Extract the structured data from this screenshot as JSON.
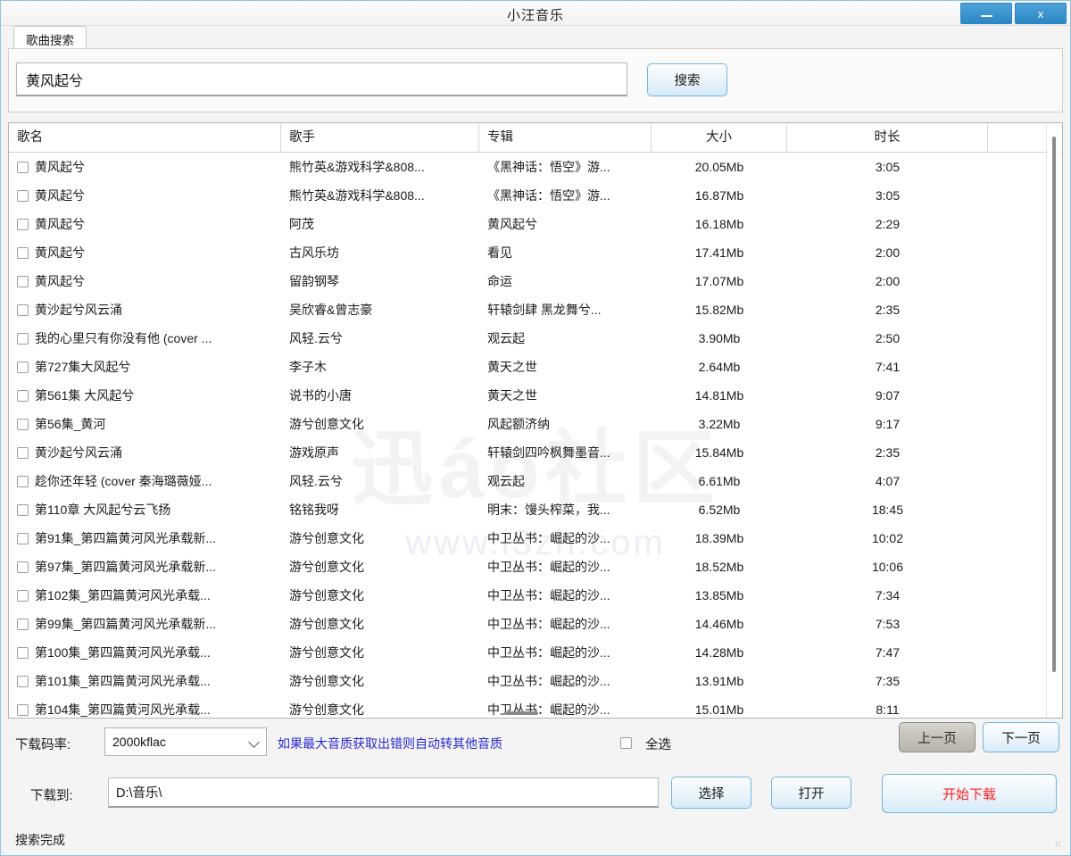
{
  "window": {
    "title": "小汪音乐",
    "minimize_icon": "minimize-icon",
    "close_label": "x"
  },
  "tabs": [
    {
      "label": "歌曲搜索"
    }
  ],
  "search": {
    "query": "黄风起兮",
    "placeholder": "",
    "button_label": "搜索"
  },
  "table": {
    "columns": [
      {
        "key": "name",
        "label": "歌名"
      },
      {
        "key": "artist",
        "label": "歌手"
      },
      {
        "key": "album",
        "label": "专辑"
      },
      {
        "key": "size",
        "label": "大小"
      },
      {
        "key": "duration",
        "label": "时长"
      }
    ],
    "rows": [
      {
        "name": "黄风起兮",
        "artist": "熊竹英&游戏科学&808...",
        "album": "《黑神话：悟空》游...",
        "size": "20.05Mb",
        "duration": "3:05"
      },
      {
        "name": "黄风起兮",
        "artist": "熊竹英&游戏科学&808...",
        "album": "《黑神话：悟空》游...",
        "size": "16.87Mb",
        "duration": "3:05"
      },
      {
        "name": "黄风起兮",
        "artist": "阿茂",
        "album": "黄风起兮",
        "size": "16.18Mb",
        "duration": "2:29"
      },
      {
        "name": "黄风起兮",
        "artist": "古风乐坊",
        "album": "看见",
        "size": "17.41Mb",
        "duration": "2:00"
      },
      {
        "name": "黄风起兮",
        "artist": "留韵钢琴",
        "album": "命运",
        "size": "17.07Mb",
        "duration": "2:00"
      },
      {
        "name": "黄沙起兮风云涌",
        "artist": "吴欣睿&曾志豪",
        "album": "轩辕剑肆 黑龙舞兮...",
        "size": "15.82Mb",
        "duration": "2:35"
      },
      {
        "name": "我的心里只有你没有他 (cover ...",
        "artist": "风轻.云兮",
        "album": "观云起",
        "size": "3.90Mb",
        "duration": "2:50"
      },
      {
        "name": "第727集大风起兮",
        "artist": "李子木",
        "album": "黄天之世",
        "size": "2.64Mb",
        "duration": "7:41"
      },
      {
        "name": "第561集 大风起兮",
        "artist": "说书的小唐",
        "album": "黄天之世",
        "size": "14.81Mb",
        "duration": "9:07"
      },
      {
        "name": "第56集_黄河",
        "artist": "游兮创意文化",
        "album": "风起额济纳",
        "size": "3.22Mb",
        "duration": "9:17"
      },
      {
        "name": "黄沙起兮风云涌",
        "artist": "游戏原声",
        "album": "轩辕剑四吟枫舞墨音...",
        "size": "15.84Mb",
        "duration": "2:35"
      },
      {
        "name": "趁你还年轻 (cover 秦海璐薇娅...",
        "artist": "风轻.云兮",
        "album": "观云起",
        "size": "6.61Mb",
        "duration": "4:07"
      },
      {
        "name": "第110章 大风起兮云飞扬",
        "artist": "铭铭我呀",
        "album": "明末：馒头榨菜，我...",
        "size": "6.52Mb",
        "duration": "18:45"
      },
      {
        "name": "第91集_第四篇黄河风光承载新...",
        "artist": "游兮创意文化",
        "album": "中卫丛书：崛起的沙...",
        "size": "18.39Mb",
        "duration": "10:02"
      },
      {
        "name": "第97集_第四篇黄河风光承载新...",
        "artist": "游兮创意文化",
        "album": "中卫丛书：崛起的沙...",
        "size": "18.52Mb",
        "duration": "10:06"
      },
      {
        "name": "第102集_第四篇黄河风光承载...",
        "artist": "游兮创意文化",
        "album": "中卫丛书：崛起的沙...",
        "size": "13.85Mb",
        "duration": "7:34"
      },
      {
        "name": "第99集_第四篇黄河风光承载新...",
        "artist": "游兮创意文化",
        "album": "中卫丛书：崛起的沙...",
        "size": "14.46Mb",
        "duration": "7:53"
      },
      {
        "name": "第100集_第四篇黄河风光承载...",
        "artist": "游兮创意文化",
        "album": "中卫丛书：崛起的沙...",
        "size": "14.28Mb",
        "duration": "7:47"
      },
      {
        "name": "第101集_第四篇黄河风光承载...",
        "artist": "游兮创意文化",
        "album": "中卫丛书：崛起的沙...",
        "size": "13.91Mb",
        "duration": "7:35"
      },
      {
        "name": "第104集_第四篇黄河风光承载...",
        "artist": "游兮创意文化",
        "album": "中卫丛书：崛起的沙...",
        "size": "15.01Mb",
        "duration": "8:11"
      }
    ]
  },
  "watermark": {
    "main": "迅áo社区",
    "sub": "www.i3zh.com"
  },
  "bottom": {
    "rate_label": "下载码率:",
    "rate_value": "2000kflac",
    "hint": "如果最大音质获取出错则自动转其他音质",
    "select_all_label": "全选",
    "prev_page_label": "上一页",
    "next_page_label": "下一页",
    "to_label": "下载到:",
    "path_value": "D:\\音乐\\",
    "path_placeholder": "",
    "choose_label": "选择",
    "open_label": "打开",
    "start_label": "开始下载"
  },
  "status": {
    "text": "搜索完成"
  },
  "colors": {
    "accent_blue": "#74b6dd",
    "titlebar_btn": "#2b87c4",
    "hint_blue": "#2a2ad0",
    "start_red": "#ff2222"
  }
}
